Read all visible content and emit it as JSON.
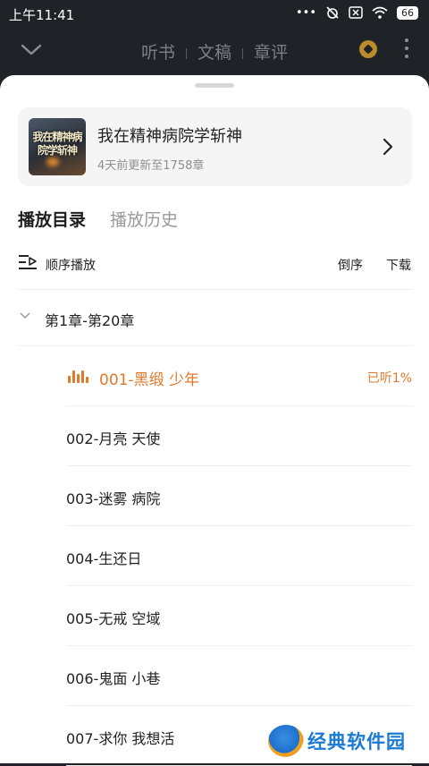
{
  "status": {
    "time": "上午11:41",
    "battery": "66"
  },
  "header": {
    "tabs": [
      "听书",
      "文稿",
      "章评"
    ]
  },
  "book": {
    "cover_text": "我在精神病院学斩神",
    "title": "我在精神病院学斩神",
    "subtitle": "4天前更新至1758章"
  },
  "panel_tabs": {
    "catalog": "播放目录",
    "history": "播放历史"
  },
  "toolbar": {
    "order": "顺序播放",
    "reverse": "倒序",
    "download": "下载"
  },
  "volume": {
    "label": "第1章-第20章"
  },
  "chapters": [
    {
      "title": "001-黑缎 少年",
      "progress": "已听1%"
    },
    {
      "title": "002-月亮 天使"
    },
    {
      "title": "003-迷雾 病院"
    },
    {
      "title": "004-生还日"
    },
    {
      "title": "005-无戒 空域"
    },
    {
      "title": "006-鬼面 小巷"
    },
    {
      "title": "007-求你 我想活"
    }
  ],
  "watermark": {
    "text": "经典软件园"
  },
  "colors": {
    "accent": "#e0792c",
    "dark_bg": "#1f2328"
  }
}
